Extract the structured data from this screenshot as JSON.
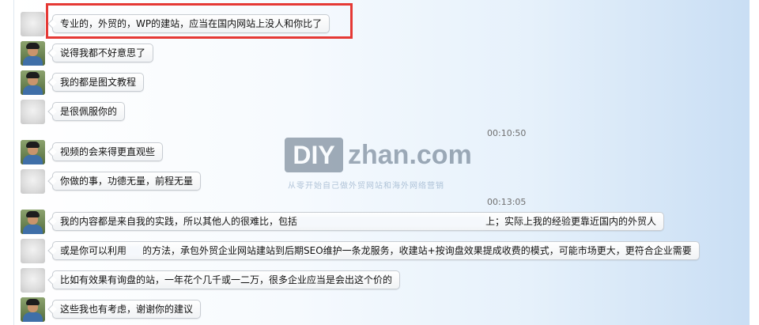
{
  "messages": [
    {
      "text": "专业的，外贸的，WP的建站，应当在国内网站上没人和你比了",
      "avatar": "blurred"
    },
    {
      "text": "说得我都不好意思了",
      "avatar": "person"
    },
    {
      "text": "我的都是图文教程",
      "avatar": "person"
    },
    {
      "text": "是很佩服你的",
      "avatar": "blurred"
    },
    {
      "text": "视频的会来得更直观些",
      "avatar": "person"
    },
    {
      "text": "你做的事，功德无量，前程无量",
      "avatar": "blurred"
    },
    {
      "text_before": "我的内容都是来自我的实践，所以其他人的很难比，包括",
      "text_after": "上；实际上我的经验更靠近国内的外贸人",
      "avatar": "person"
    },
    {
      "text_before": "或是你可以利用",
      "text_after": "的方法，承包外贸企业网站建站到后期SEO维护一条龙服务，收建站+按询盘效果提成收费的模式，可能市场更大，更符合企业需要",
      "avatar": "blurred"
    },
    {
      "text": "比如有效果有询盘的站，一年花个几千或一二万，很多企业应当是会出这个价的",
      "avatar": "blurred"
    },
    {
      "text": "这些我也有考虑，谢谢你的建议",
      "avatar": "person"
    }
  ],
  "timestamps": [
    "00:10:50",
    "00:13:05"
  ],
  "watermark": {
    "logo_box": "DIY",
    "logo_text": "zhan.com",
    "slogan": "从零开始自己做外贸网站和海外网络营销"
  },
  "colors": {
    "highlight": "#e53935",
    "watermark": "#4a5e73"
  }
}
